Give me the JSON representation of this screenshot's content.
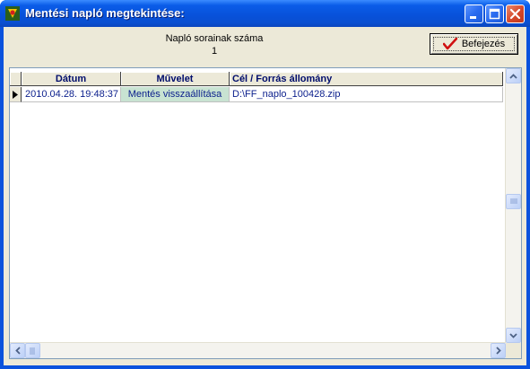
{
  "window": {
    "title": "Mentési napló megtekintése:"
  },
  "summary": {
    "count_label": "Napló sorainak száma",
    "count_value": "1"
  },
  "toolbar": {
    "finish_label": "Befejezés"
  },
  "table": {
    "columns": [
      "Dátum",
      "Művelet",
      "Cél / Forrás állomány"
    ],
    "rows": [
      [
        "2010.04.28. 19:48:37",
        "Mentés visszaállítása",
        "D:\\FF_naplo_100428.zip"
      ]
    ]
  },
  "icons": {
    "app": "app-icon",
    "minimize": "minimize-icon",
    "maximize": "maximize-icon",
    "close": "close-icon",
    "finish": "checkmark-icon",
    "row_indicator": "row-pointer-icon"
  },
  "colors": {
    "titlebar": "#0a52dd",
    "header_text": "#000d6b",
    "cell_text": "#0a1e8c",
    "operation_cell_bg": "#c8e3d2"
  }
}
